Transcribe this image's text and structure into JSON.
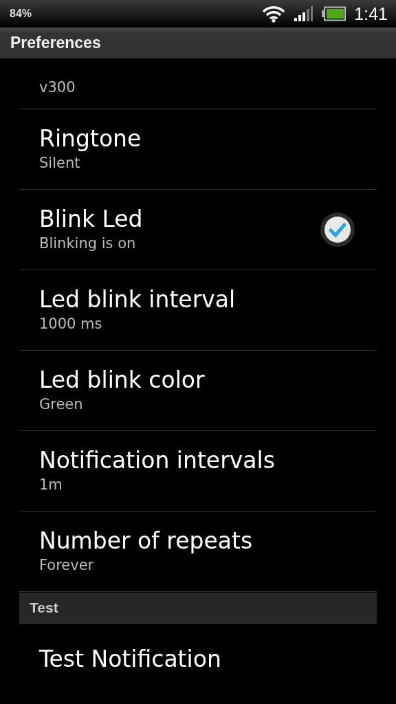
{
  "status_bar": {
    "battery_percent": "84%",
    "time": "1:41"
  },
  "action_bar": {
    "title": "Preferences"
  },
  "items": [
    {
      "kind": "text",
      "summary": "v300"
    },
    {
      "kind": "text",
      "title": "Ringtone",
      "summary": "Silent"
    },
    {
      "kind": "checkbox",
      "title": "Blink Led",
      "summary": "Blinking is on",
      "checked": true
    },
    {
      "kind": "text",
      "title": "Led blink interval",
      "summary": "1000 ms"
    },
    {
      "kind": "text",
      "title": "Led blink color",
      "summary": "Green"
    },
    {
      "kind": "text",
      "title": "Notification intervals",
      "summary": "1m"
    },
    {
      "kind": "text",
      "title": "Number of repeats",
      "summary": "Forever"
    },
    {
      "kind": "header",
      "title": "Test"
    },
    {
      "kind": "text",
      "title": "Test Notification"
    }
  ]
}
